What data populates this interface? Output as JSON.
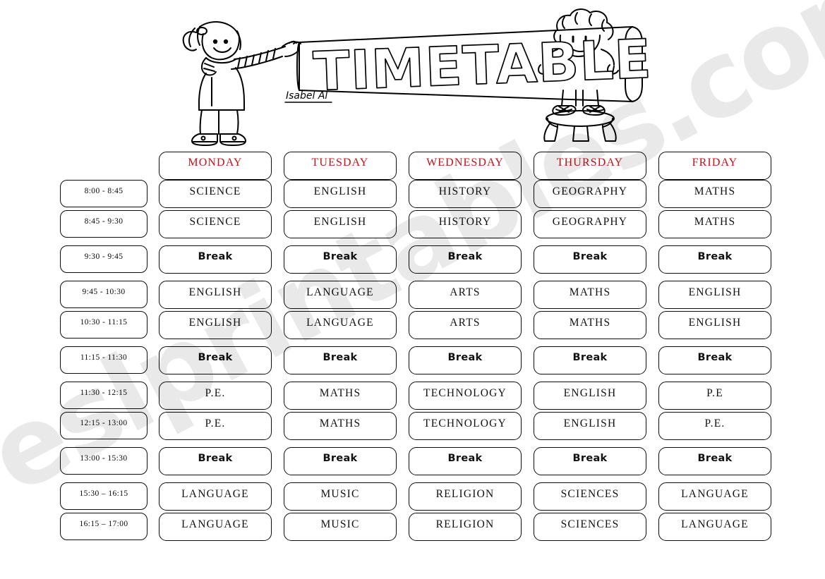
{
  "header": {
    "title": "TIMETABLE",
    "signature": "Isabel Al",
    "left_character": "girl-with-scarf",
    "right_character": "boy-on-stool"
  },
  "watermark": {
    "text": "eslprintables.com"
  },
  "colors": {
    "day_header": "#c0131a",
    "border": "#0c0c0c",
    "text": "#111111",
    "background": "#ffffff",
    "watermark": "rgba(0,0,0,0.085)"
  },
  "table": {
    "time_column_header": "",
    "days": [
      "MONDAY",
      "TUESDAY",
      "WEDNESDAY",
      "THURSDAY",
      "FRIDAY"
    ],
    "rows": [
      {
        "time": "8:00 - 8:45",
        "kind": "class",
        "gap": "head",
        "cells": [
          "SCIENCE",
          "ENGLISH",
          "HISTORY",
          "GEOGRAPHY",
          "MATHS"
        ]
      },
      {
        "time": "8:45 - 9:30",
        "kind": "class",
        "gap": "tight",
        "cells": [
          "SCIENCE",
          "ENGLISH",
          "HISTORY",
          "GEOGRAPHY",
          "MATHS"
        ]
      },
      {
        "time": "9:30 - 9:45",
        "kind": "break",
        "gap": "loose",
        "cells": [
          "Break",
          "Break",
          "Break",
          "Break",
          "Break"
        ]
      },
      {
        "time": "9:45 - 10:30",
        "kind": "class",
        "gap": "loose",
        "cells": [
          "ENGLISH",
          "LANGUAGE",
          "ARTS",
          "MATHS",
          "ENGLISH"
        ]
      },
      {
        "time": "10:30 - 11:15",
        "kind": "class",
        "gap": "tight",
        "cells": [
          "ENGLISH",
          "LANGUAGE",
          "ARTS",
          "MATHS",
          "ENGLISH"
        ]
      },
      {
        "time": "11:15 - 11:30",
        "kind": "break",
        "gap": "loose",
        "cells": [
          "Break",
          "Break",
          "Break",
          "Break",
          "Break"
        ]
      },
      {
        "time": "11:30 - 12:15",
        "kind": "class",
        "gap": "loose",
        "cells": [
          "P.E.",
          "MATHS",
          "TECHNOLOGY",
          "ENGLISH",
          "P.E"
        ]
      },
      {
        "time": "12:15 - 13:00",
        "kind": "class",
        "gap": "tight",
        "cells": [
          "P.E.",
          "MATHS",
          "TECHNOLOGY",
          "ENGLISH",
          "P.E."
        ]
      },
      {
        "time": "13:00 - 15:30",
        "kind": "break",
        "gap": "loose",
        "cells": [
          "Break",
          "Break",
          "Break",
          "Break",
          "Break"
        ]
      },
      {
        "time": "15:30 – 16:15",
        "kind": "class",
        "gap": "loose",
        "cells": [
          "LANGUAGE",
          "MUSIC",
          "RELIGION",
          "SCIENCES",
          "LANGUAGE"
        ]
      },
      {
        "time": "16:15 – 17:00",
        "kind": "class",
        "gap": "tight",
        "cells": [
          "LANGUAGE",
          "MUSIC",
          "RELIGION",
          "SCIENCES",
          "LANGUAGE"
        ]
      }
    ]
  }
}
